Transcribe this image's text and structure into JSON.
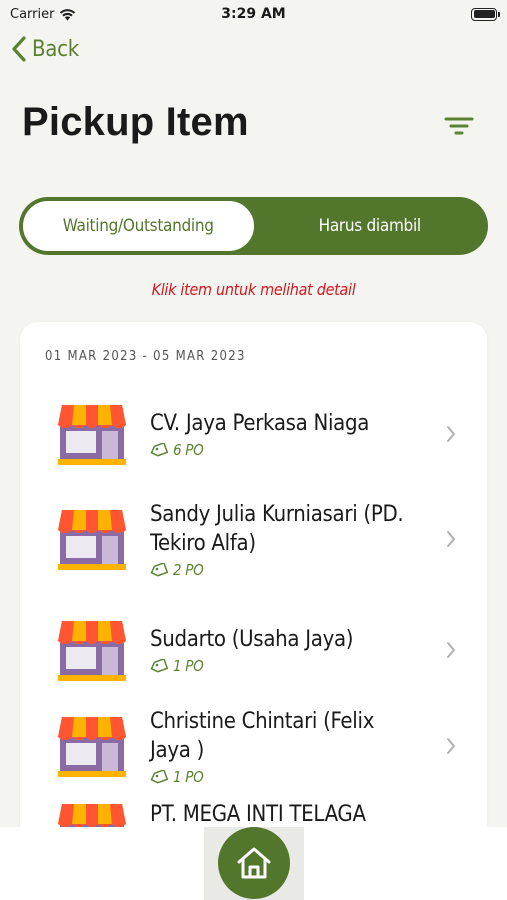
{
  "status_bar": {
    "carrier": "Carrier",
    "time": "3:29 AM",
    "wifi_icon": "wifi-icon",
    "battery_icon": "battery-icon"
  },
  "nav": {
    "back_label": "Back",
    "back_icon": "chevron-left-icon",
    "filter_icon": "filter-icon"
  },
  "page": {
    "title": "Pickup Item"
  },
  "tabs": [
    {
      "label": "Waiting/Outstanding",
      "active": true
    },
    {
      "label": "Harus diambil",
      "active": false
    }
  ],
  "hint": "Klik item untuk melihat detail",
  "list": {
    "date_range": "01 MAR 2023 - 05 MAR 2023",
    "items": [
      {
        "name": "CV. Jaya Perkasa Niaga",
        "po": "6 PO",
        "icon": "store-icon"
      },
      {
        "name": "Sandy Julia Kurniasari (PD. Tekiro Alfa)",
        "po": "2 PO",
        "icon": "store-icon"
      },
      {
        "name": "Sudarto (Usaha Jaya)",
        "po": "1 PO",
        "icon": "store-icon"
      },
      {
        "name": "Christine Chintari (Felix Jaya )",
        "po": "1 PO",
        "icon": "store-icon"
      },
      {
        "name": "PT. MEGA INTI TELAGA",
        "po": "",
        "icon": "store-icon"
      }
    ]
  },
  "bottom_nav": {
    "home_icon": "home-icon"
  },
  "colors": {
    "accent": "#52772c",
    "hint": "#d6181e",
    "background": "#f4f4f1",
    "card": "#ffffff"
  }
}
